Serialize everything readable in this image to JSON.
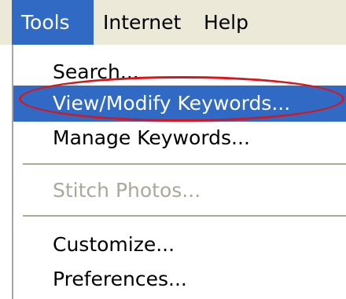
{
  "menubar": {
    "items": [
      {
        "label": "Tools"
      },
      {
        "label": "Internet"
      },
      {
        "label": "Help"
      }
    ]
  },
  "tools_menu": {
    "items": [
      {
        "label": "Search..."
      },
      {
        "label": "View/Modify Keywords..."
      },
      {
        "label": "Manage Keywords..."
      },
      {
        "label": "Stitch Photos..."
      },
      {
        "label": "Customize..."
      },
      {
        "label": "Preferences..."
      }
    ]
  },
  "colors": {
    "highlight": "#316ac5",
    "callout": "#d9161c",
    "disabled_text": "#aca899"
  }
}
